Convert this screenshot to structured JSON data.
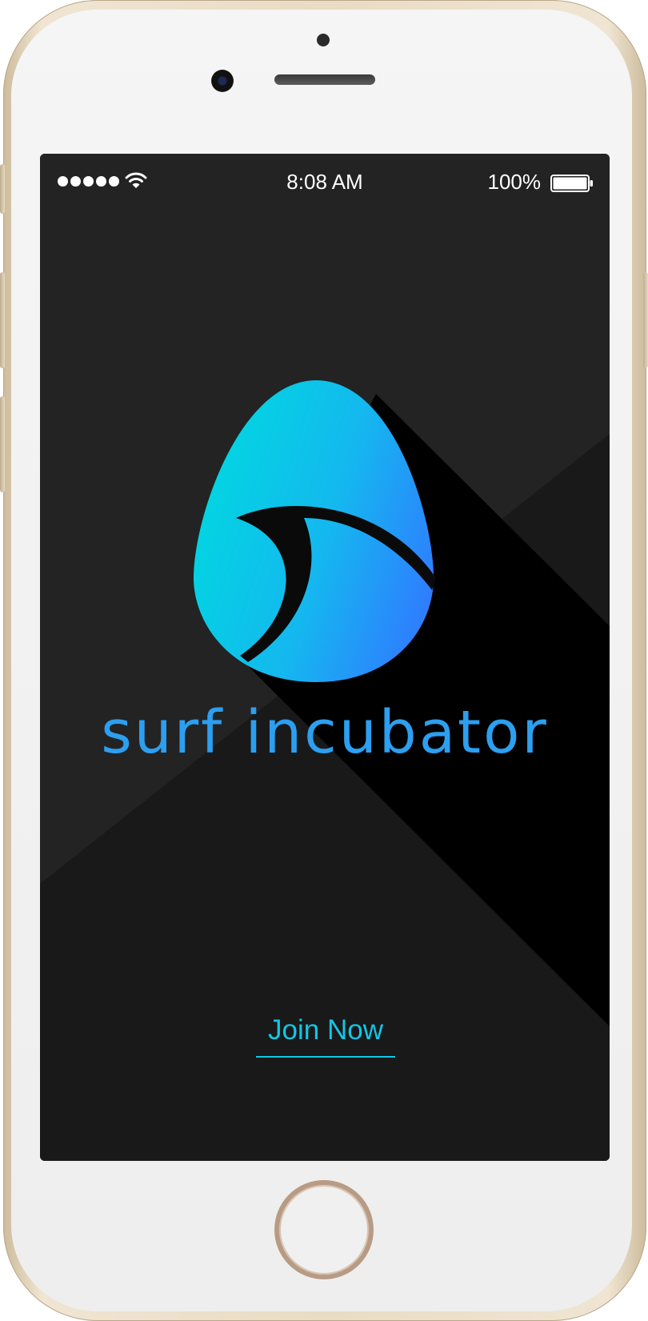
{
  "status_bar": {
    "signal_dots": 5,
    "time": "8:08 AM",
    "battery": "100%",
    "icons": [
      "signal-dots-icon",
      "wifi-icon",
      "battery-icon"
    ]
  },
  "app": {
    "brand_name": "surf incubator",
    "logo": "surf-egg-wave-logo",
    "join_label": "Join Now"
  },
  "colors": {
    "screen_bg": "#1a1a1a",
    "brand_text": "#2c9ff0",
    "logo_gradient_start": "#00d8e0",
    "logo_gradient_end": "#2f7dff",
    "join_accent": "#12c6e6"
  }
}
